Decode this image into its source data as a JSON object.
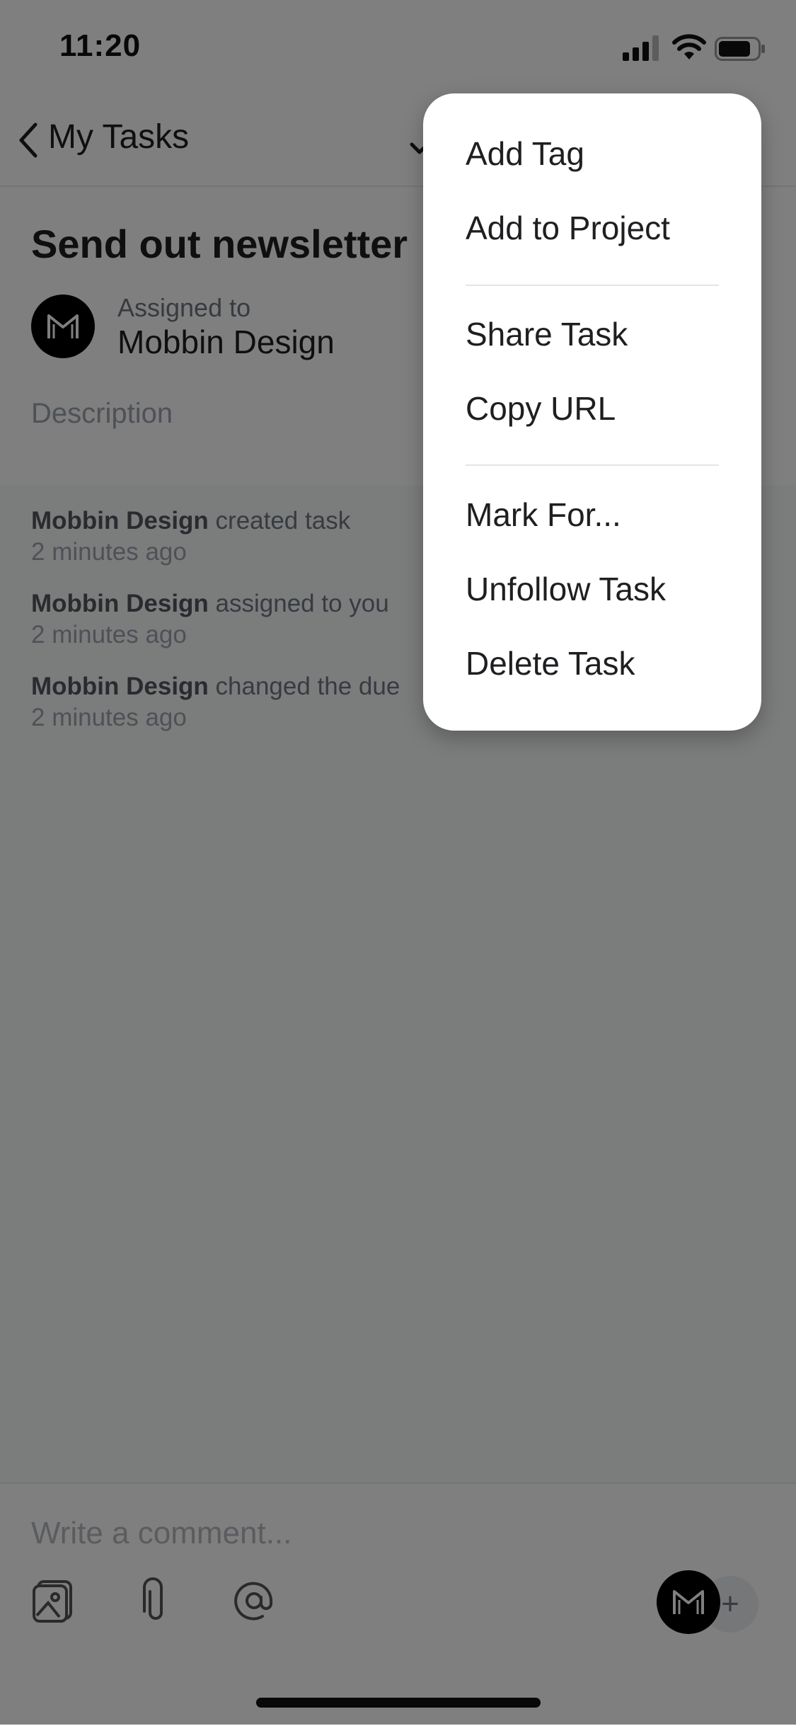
{
  "status_bar": {
    "time": "11:20"
  },
  "nav": {
    "back_label": "My Tasks"
  },
  "task": {
    "title": "Send out newsletter",
    "assigned_label": "Assigned to",
    "assignee": "Mobbin Design",
    "description_placeholder": "Description"
  },
  "activity": [
    {
      "actor": "Mobbin Design",
      "action": " created task",
      "time": "2 minutes ago"
    },
    {
      "actor": "Mobbin Design",
      "action": " assigned to you",
      "time": "2 minutes ago"
    },
    {
      "actor": "Mobbin Design",
      "action": " changed the due",
      "time": "2 minutes ago"
    }
  ],
  "composer": {
    "placeholder": "Write a comment...",
    "add_label": "+",
    "icons": [
      "image-icon",
      "attachment-icon",
      "mention-icon"
    ]
  },
  "menu": {
    "items": [
      "Add Tag",
      "Add to Project",
      "Share Task",
      "Copy URL",
      "Mark For...",
      "Unfollow Task",
      "Delete Task"
    ]
  }
}
